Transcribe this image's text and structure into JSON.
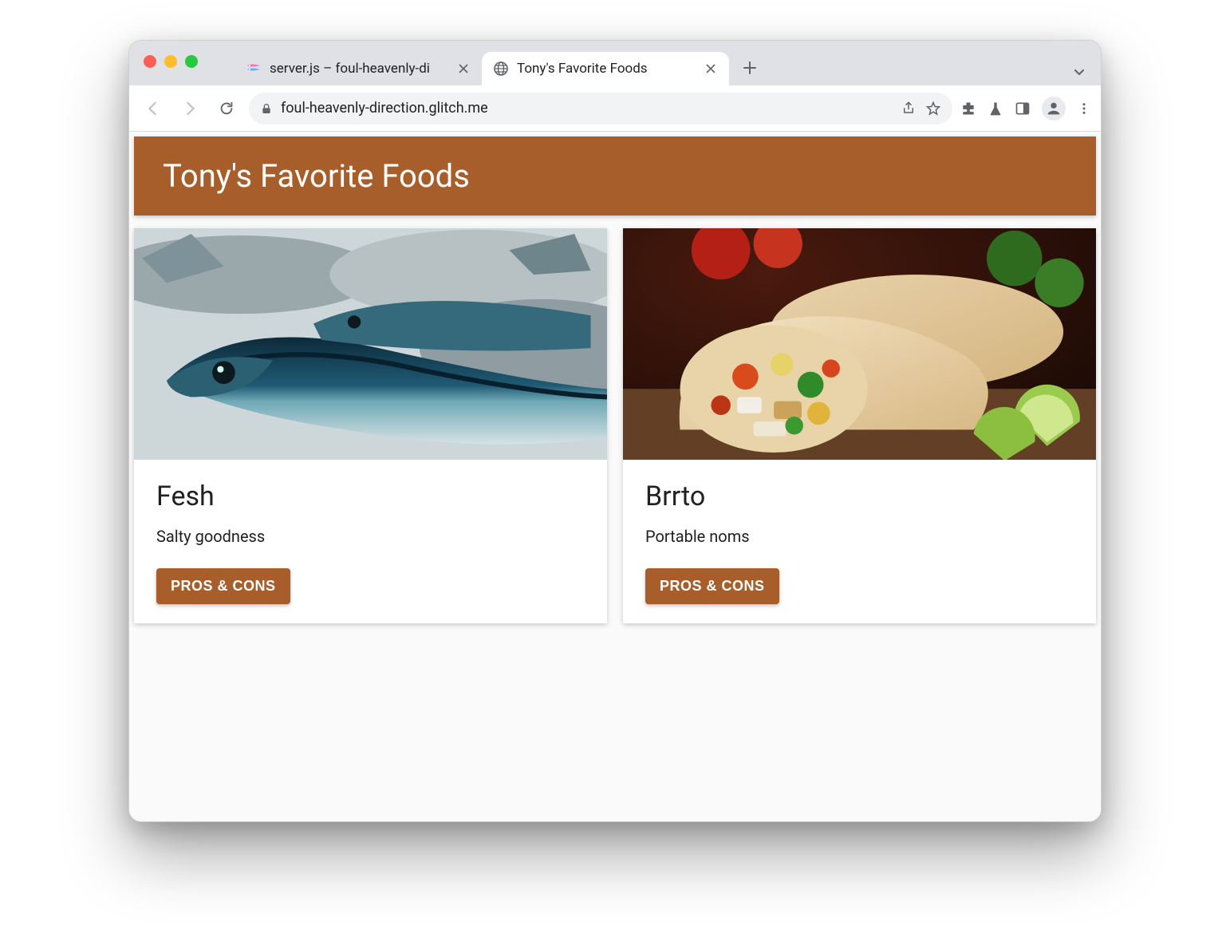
{
  "browser": {
    "tabs": [
      {
        "title": "server.js – foul-heavenly-di",
        "active": false,
        "favicon": "glitch-icon"
      },
      {
        "title": "Tony's Favorite Foods",
        "active": true,
        "favicon": "globe-icon"
      }
    ],
    "url": "foul-heavenly-direction.glitch.me"
  },
  "page": {
    "header": "Tony's Favorite Foods",
    "cards": [
      {
        "title": "Fesh",
        "desc": "Salty goodness",
        "button": "PROS & CONS",
        "image": "fish"
      },
      {
        "title": "Brrto",
        "desc": "Portable noms",
        "button": "PROS & CONS",
        "image": "burrito"
      }
    ]
  },
  "colors": {
    "accent": "#a75e2b"
  }
}
